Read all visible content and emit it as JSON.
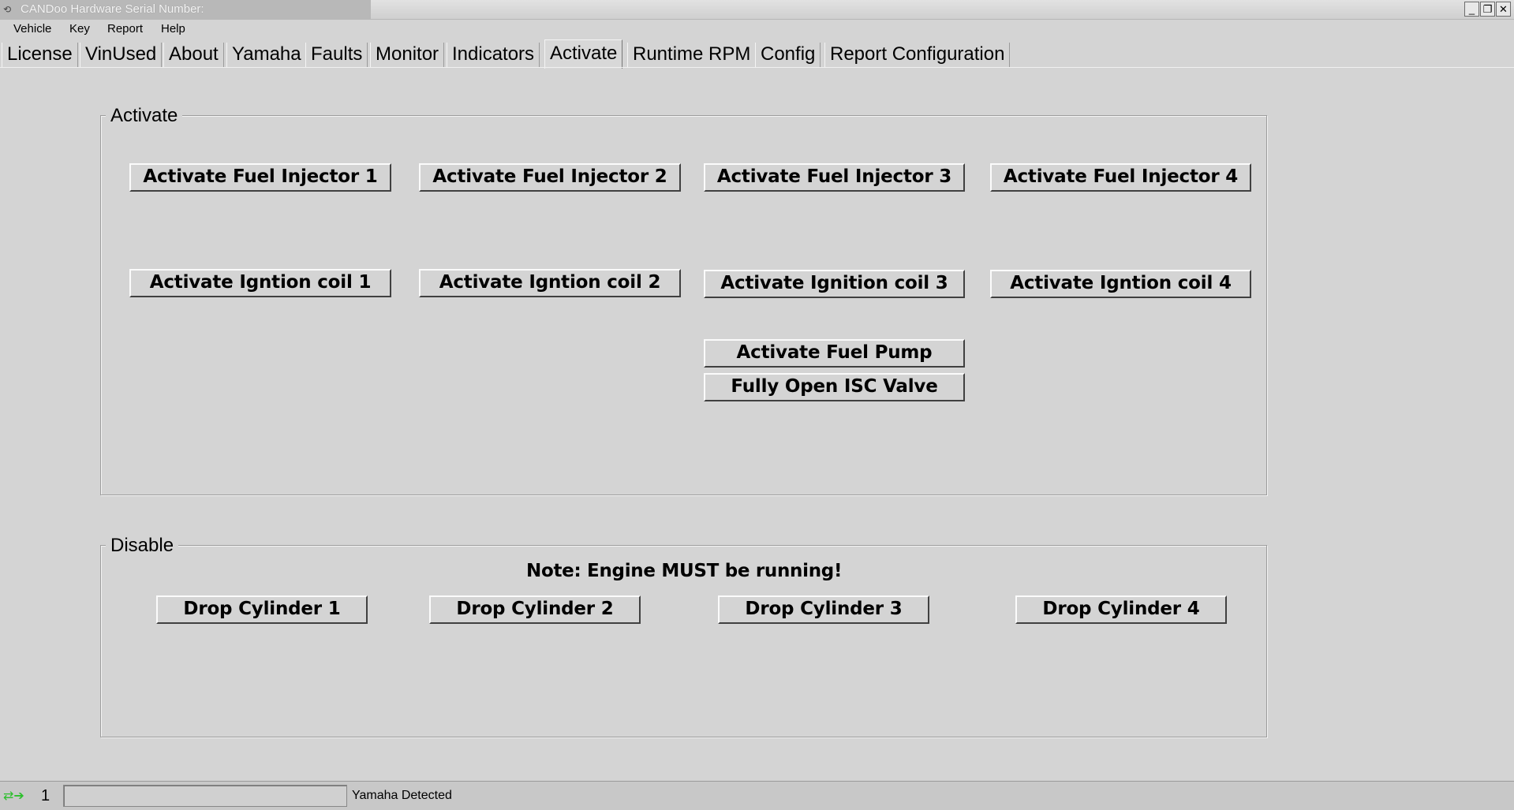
{
  "window": {
    "title": "CANDoo  Hardware Serial Number:",
    "minimize_glyph": "_",
    "restore_glyph": "❐",
    "close_glyph": "✕"
  },
  "menu": [
    "Vehicle",
    "Key",
    "Report",
    "Help"
  ],
  "tabs": [
    {
      "label": "License"
    },
    {
      "label": "VinUsed"
    },
    {
      "label": "About"
    },
    {
      "label": "Yamaha"
    },
    {
      "label": "Faults"
    },
    {
      "label": "Monitor"
    },
    {
      "label": "Indicators"
    },
    {
      "label": "Activate",
      "active": true
    },
    {
      "label": "Runtime RPM"
    },
    {
      "label": "Config"
    },
    {
      "label": "Report Configuration"
    }
  ],
  "activate_group": {
    "label": "Activate",
    "injectors": [
      "Activate Fuel Injector 1",
      "Activate Fuel Injector 2",
      "Activate Fuel Injector 3",
      "Activate Fuel Injector 4"
    ],
    "coils": [
      "Activate Igntion coil 1",
      "Activate Igntion coil 2",
      "Activate Ignition coil 3",
      "Activate Igntion coil 4"
    ],
    "fuel_pump": "Activate Fuel Pump",
    "isc_valve": "Fully Open  ISC Valve"
  },
  "disable_group": {
    "label": "Disable",
    "note": "Note: Engine MUST be running!",
    "cylinders": [
      "Drop Cylinder 1",
      "Drop Cylinder 2",
      "Drop Cylinder 3",
      "Drop Cylinder 4"
    ]
  },
  "statusbar": {
    "count": "1",
    "status_text": "Yamaha Detected",
    "icon": "connection-arrows-icon",
    "icon_color": "#2cbf2c"
  }
}
